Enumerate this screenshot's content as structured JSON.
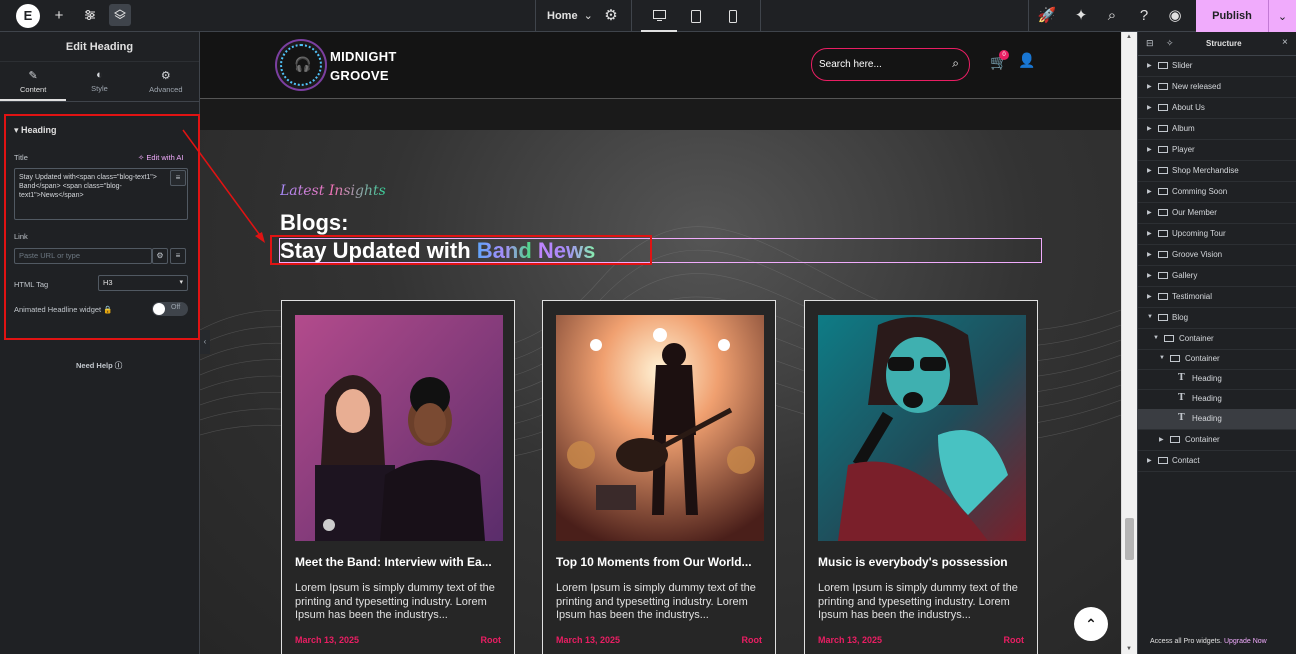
{
  "topbar": {
    "logo": "E",
    "page_name": "Home",
    "publish_label": "Publish"
  },
  "left_panel": {
    "title": "Edit Heading",
    "tabs": [
      {
        "label": "Content",
        "icon": "pencil-icon"
      },
      {
        "label": "Style",
        "icon": "half-circle-icon"
      },
      {
        "label": "Advanced",
        "icon": "gear-icon"
      }
    ],
    "section_title": "Heading",
    "title_label": "Title",
    "edit_ai_label": "Edit with AI",
    "title_value": "Stay Updated with<span class=\"blog-text1\"> Band</span> <span class=\"blog-text1\">News</span>",
    "link_label": "Link",
    "link_placeholder": "Paste URL or type",
    "html_tag_label": "HTML Tag",
    "html_tag_value": "H3",
    "animated_label": "Animated Headline widget",
    "toggle_label": "Off",
    "need_help": "Need Help"
  },
  "site": {
    "logo_line1": "MIDNIGHT",
    "logo_line2": "GROOVE",
    "search_placeholder": "Search here...",
    "cart_count": "0",
    "latest_label": "Latest Insights",
    "section_title": "Blogs:",
    "heading_prefix": "Stay Updated with ",
    "heading_band": "Band",
    "heading_news": "News",
    "cards": [
      {
        "title": "Meet the Band: Interview with Ea...",
        "excerpt": "Lorem Ipsum is simply dummy text of the printing and typesetting industry. Lorem Ipsum has been the industrys...",
        "date": "March 13, 2025",
        "author": "Root"
      },
      {
        "title": "Top 10 Moments from Our World...",
        "excerpt": "Lorem Ipsum is simply dummy text of the printing and typesetting industry. Lorem Ipsum has been the industrys...",
        "date": "March 13, 2025",
        "author": "Root"
      },
      {
        "title": "Music is everybody's possession",
        "excerpt": "Lorem Ipsum is simply dummy text of the printing and typesetting industry. Lorem Ipsum has been the industrys...",
        "date": "March 13, 2025",
        "author": "Root"
      }
    ]
  },
  "structure": {
    "title": "Structure",
    "items": [
      {
        "label": "Slider"
      },
      {
        "label": "New released"
      },
      {
        "label": "About Us"
      },
      {
        "label": "Album"
      },
      {
        "label": "Player"
      },
      {
        "label": "Shop Merchandise"
      },
      {
        "label": "Comming Soon"
      },
      {
        "label": "Our Member"
      },
      {
        "label": "Upcoming Tour"
      },
      {
        "label": "Groove Vision"
      },
      {
        "label": "Gallery"
      },
      {
        "label": "Testimonial"
      },
      {
        "label": "Blog"
      },
      {
        "label": "Container"
      },
      {
        "label": "Container"
      },
      {
        "label": "Heading"
      },
      {
        "label": "Heading"
      },
      {
        "label": "Heading"
      },
      {
        "label": "Container"
      },
      {
        "label": "Contact"
      }
    ],
    "pro_note": "Access all Pro widgets.",
    "upgrade_label": "Upgrade Now"
  },
  "colors": {
    "accent": "#f0abfc",
    "brand_pink": "#e91e63",
    "annotation_red": "#e01313"
  }
}
